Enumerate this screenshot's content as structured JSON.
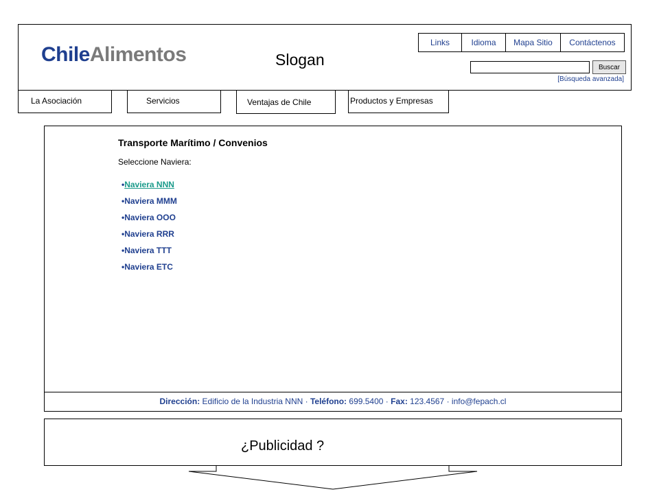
{
  "header": {
    "logo_part1": "Chile",
    "logo_part2": "Alimentos",
    "slogan": "Slogan",
    "top_links": [
      "Links",
      "Idioma",
      "Mapa Sitio",
      "Contáctenos"
    ],
    "search": {
      "value": "",
      "button": "Buscar",
      "advanced": "[Búsqueda avanzada]"
    },
    "colors": {
      "brand": "#1f3f8f",
      "brand_secondary": "#7a7a7a",
      "active_link": "#1a9a8a"
    }
  },
  "nav": {
    "items": [
      "La Asociación",
      "Servicios",
      "Ventajas de Chile",
      "Productos y Empresas"
    ]
  },
  "main": {
    "title": "Transporte Marítimo  / Convenios",
    "instruction": "Seleccione Naviera:",
    "navieras": [
      "Naviera NNN",
      "Naviera MMM",
      "Naviera OOO",
      "Naviera RRR",
      "Naviera TTT",
      "Naviera ETC"
    ],
    "active_index": 0
  },
  "footer": {
    "direccion_label": "Dirección:",
    "direccion": "Edificio de la Industria NNN",
    "telefono_label": "Teléfono:",
    "telefono": "699.5400",
    "fax_label": "Fax:",
    "fax": "123.4567",
    "email": "info@fepach.cl"
  },
  "ad": {
    "text": "¿Publicidad ?"
  }
}
